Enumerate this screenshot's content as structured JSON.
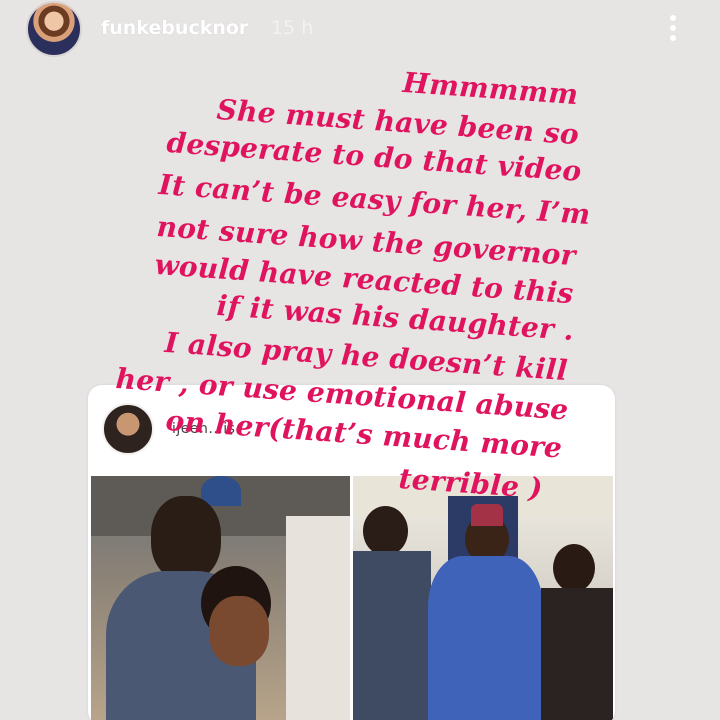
{
  "header": {
    "username": "funkebucknor",
    "time": "15 h"
  },
  "caption_lines": [
    "Hmmmmm",
    "She must have  been so",
    "desperate to do that video",
    "It can’t be easy for her, I’m",
    "not sure how the governor",
    "would have reacted to this",
    "if it was his daughter .",
    "I also pray he doesn’t kill",
    "her , or use emotional abuse",
    "on her(that’s much more",
    "terrible )"
  ],
  "repost": {
    "username": "ijeen...is"
  },
  "colors": {
    "caption": "#e0145e",
    "background": "#e7e4e4"
  },
  "icons": {
    "more": "vertical-dots-icon"
  }
}
